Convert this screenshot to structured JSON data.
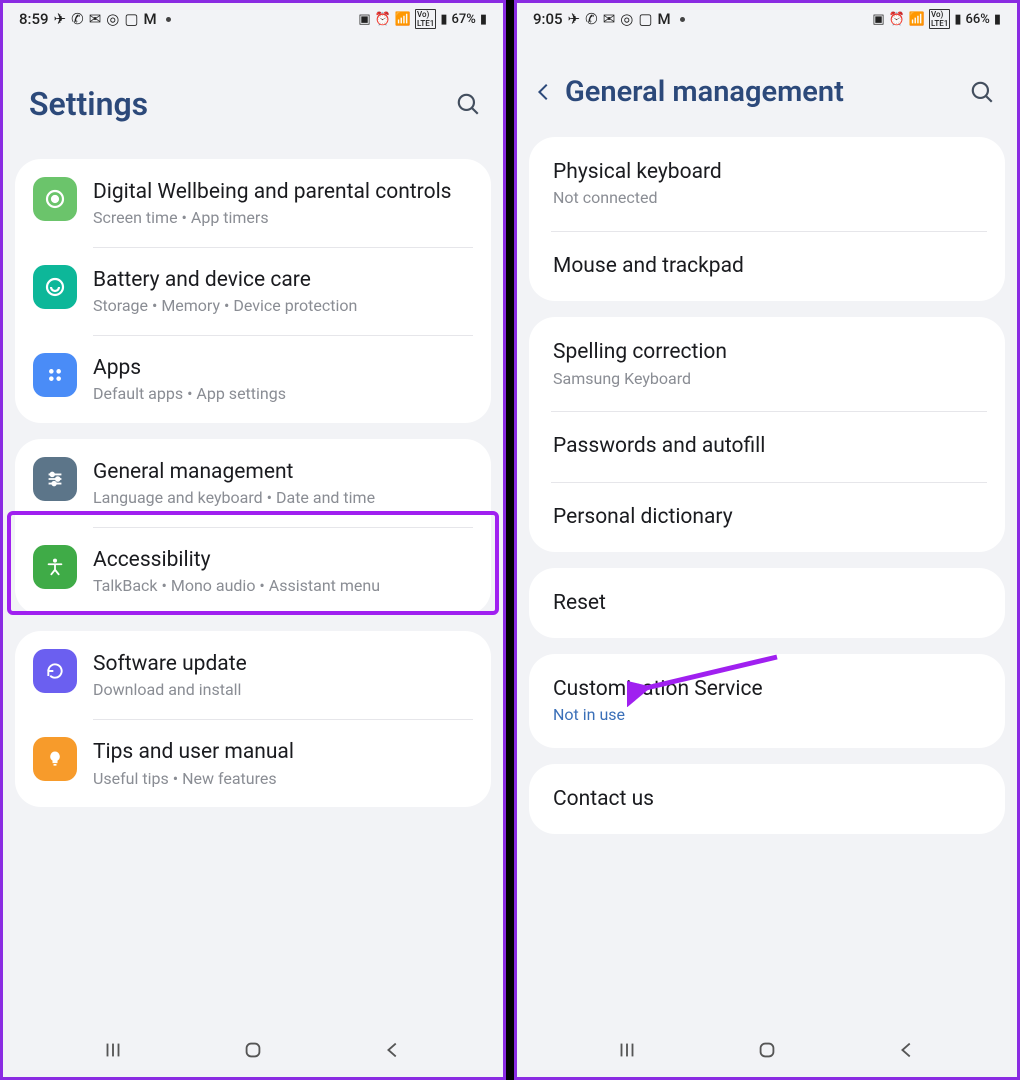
{
  "left": {
    "status": {
      "time": "8:59",
      "battery": "67%"
    },
    "title": "Settings",
    "groups": [
      [
        {
          "key": "wellbeing",
          "title": "Digital Wellbeing and parental controls",
          "sub": "Screen time  •  App timers"
        },
        {
          "key": "battery",
          "title": "Battery and device care",
          "sub": "Storage  •  Memory  •  Device protection"
        },
        {
          "key": "apps",
          "title": "Apps",
          "sub": "Default apps  •  App settings"
        }
      ],
      [
        {
          "key": "general",
          "title": "General management",
          "sub": "Language and keyboard  •  Date and time"
        },
        {
          "key": "access",
          "title": "Accessibility",
          "sub": "TalkBack  •  Mono audio  •  Assistant menu"
        }
      ],
      [
        {
          "key": "software",
          "title": "Software update",
          "sub": "Download and install"
        },
        {
          "key": "tips",
          "title": "Tips and user manual",
          "sub": "Useful tips  •  New features"
        }
      ]
    ]
  },
  "right": {
    "status": {
      "time": "9:05",
      "battery": "66%"
    },
    "title": "General management",
    "groups": [
      [
        {
          "key": "phys-kbd",
          "title": "Physical keyboard",
          "sub": "Not connected"
        },
        {
          "key": "mouse",
          "title": "Mouse and trackpad"
        }
      ],
      [
        {
          "key": "spell",
          "title": "Spelling correction",
          "sub": "Samsung Keyboard"
        },
        {
          "key": "passwords",
          "title": "Passwords and autofill"
        },
        {
          "key": "dict",
          "title": "Personal dictionary"
        }
      ],
      [
        {
          "key": "reset",
          "title": "Reset"
        }
      ],
      [
        {
          "key": "custom",
          "title": "Customisation Service",
          "sub": "Not in use",
          "blue": true
        }
      ],
      [
        {
          "key": "contact",
          "title": "Contact us"
        }
      ]
    ]
  }
}
